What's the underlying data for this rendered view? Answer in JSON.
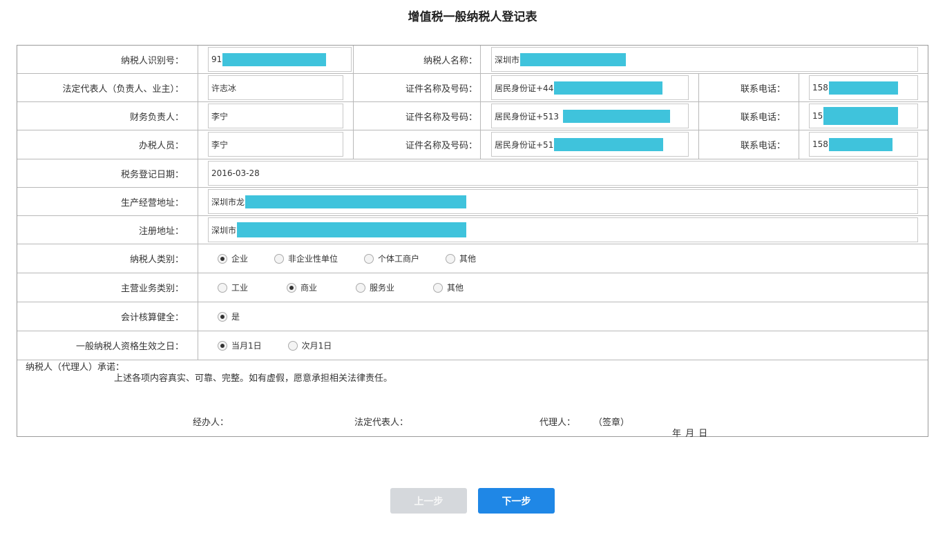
{
  "page": {
    "title": "增值税一般纳税人登记表"
  },
  "form": {
    "taxpayer_id": {
      "label": "纳税人识别号：",
      "value": "91"
    },
    "taxpayer_name": {
      "label": "纳税人名称：",
      "value": "深圳市"
    },
    "legal_rep": {
      "label": "法定代表人（负责人、业主）：",
      "value": "许志冰",
      "id_label": "证件名称及号码：",
      "id_value": "居民身份证+44",
      "phone_label": "联系电话：",
      "phone_value": "158"
    },
    "finance_head": {
      "label": "财务负责人：",
      "value": "李宁",
      "id_label": "证件名称及号码：",
      "id_value": "居民身份证+513",
      "phone_label": "联系电话：",
      "phone_value": "15"
    },
    "handler": {
      "label": "办税人员：",
      "value": "李宁",
      "id_label": "证件名称及号码：",
      "id_value": "居民身份证+51",
      "phone_label": "联系电话：",
      "phone_value": "158"
    },
    "reg_date": {
      "label": "税务登记日期：",
      "value": "2016-03-28"
    },
    "business_address": {
      "label": "生产经营地址：",
      "value": "深圳市龙"
    },
    "registered_address": {
      "label": "注册地址：",
      "value": "深圳市"
    },
    "taxpayer_type": {
      "label": "纳税人类别：",
      "options": [
        "企业",
        "非企业性单位",
        "个体工商户",
        "其他"
      ],
      "selected": "企业"
    },
    "business_type": {
      "label": "主营业务类别：",
      "options": [
        "工业",
        "商业",
        "服务业",
        "其他"
      ],
      "selected": "商业"
    },
    "accounting": {
      "label": "会计核算健全：",
      "options": [
        "是"
      ],
      "selected": "是"
    },
    "effective_date": {
      "label": "一般纳税人资格生效之日：",
      "options": [
        "当月1日",
        "次月1日"
      ],
      "selected": "当月1日"
    }
  },
  "pledge": {
    "heading": "纳税人（代理人）承诺：",
    "text": "上述各项内容真实、可靠、完整。如有虚假，愿意承担相关法律责任。",
    "handler_label": "经办人：",
    "legal_rep_label": "法定代表人：",
    "agent_label": "代理人：",
    "seal_label": "（签章）",
    "date_text": "年  月  日"
  },
  "buttons": {
    "prev": "上一步",
    "next": "下一步"
  },
  "colors": {
    "mask": "#3fc3dc",
    "primary": "#1f87e6",
    "disabled": "#d5d8dc"
  }
}
